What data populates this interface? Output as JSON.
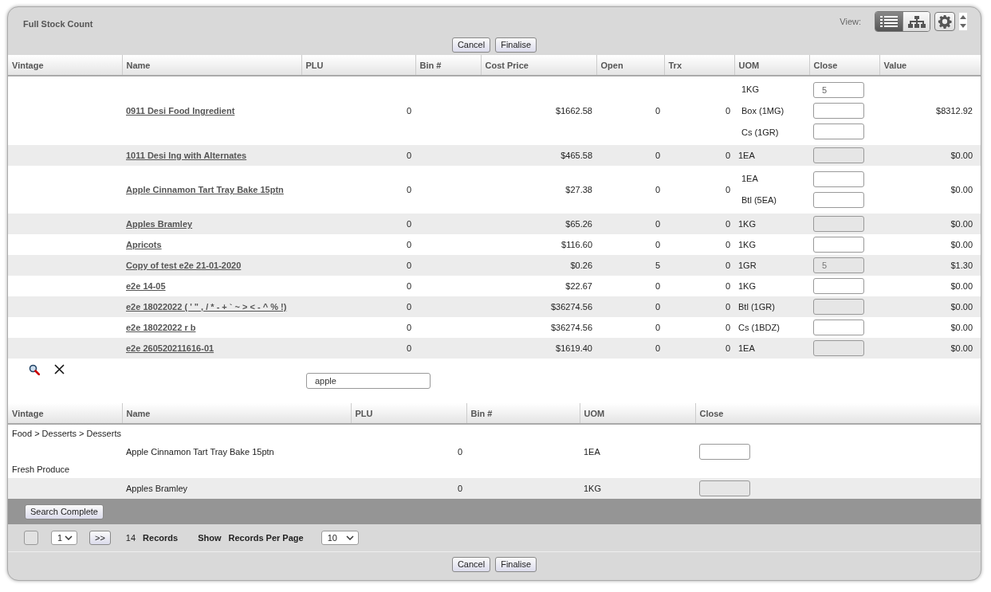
{
  "title": "Full Stock Count",
  "view": {
    "label": "View:",
    "modes": [
      {
        "kind": "list",
        "selected": true
      },
      {
        "kind": "tree",
        "selected": false
      }
    ]
  },
  "top_buttons": [
    "Cancel",
    "Finalise"
  ],
  "stock_table": {
    "columns": [
      "Vintage",
      "Name",
      "PLU",
      "Bin #",
      "Cost Price",
      "Open",
      "Trx",
      "UOM",
      "Close",
      "Value"
    ],
    "rows": [
      {
        "name": "0911 Desi Food Ingredient",
        "plu": "0",
        "cost_price": "$1662.58",
        "open": "0",
        "trx": "0",
        "uoms": [
          {
            "uom": "1KG",
            "close": "5",
            "disabled": false
          },
          {
            "uom": "Box (1MG)",
            "disabled": false
          },
          {
            "uom": "Cs (1GR)",
            "disabled": false
          }
        ],
        "value": "$8312.92"
      },
      {
        "name": "1011 Desi Ing with Alternates",
        "plu": "0",
        "cost_price": "$465.58",
        "open": "0",
        "trx": "0",
        "uoms": [
          {
            "uom": "1EA",
            "disabled": true
          }
        ],
        "value": "$0.00"
      },
      {
        "name": "Apple Cinnamon Tart Tray Bake 15ptn",
        "plu": "0",
        "cost_price": "$27.38",
        "open": "0",
        "trx": "0",
        "uoms": [
          {
            "uom": "1EA",
            "disabled": false
          },
          {
            "uom": "Btl (5EA)",
            "disabled": false
          }
        ],
        "value": "$0.00"
      },
      {
        "name": "Apples Bramley",
        "plu": "0",
        "cost_price": "$65.26",
        "open": "0",
        "trx": "0",
        "uoms": [
          {
            "uom": "1KG",
            "disabled": true
          }
        ],
        "value": "$0.00"
      },
      {
        "name": "Apricots",
        "plu": "0",
        "cost_price": "$116.60",
        "open": "0",
        "trx": "0",
        "uoms": [
          {
            "uom": "1KG",
            "disabled": false
          }
        ],
        "value": "$0.00"
      },
      {
        "name": "Copy of test e2e 21-01-2020",
        "plu": "0",
        "cost_price": "$0.26",
        "open": "5",
        "trx": "0",
        "uoms": [
          {
            "uom": "1GR",
            "close": "5",
            "disabled": true
          }
        ],
        "value": "$1.30"
      },
      {
        "name": "e2e 14-05",
        "plu": "0",
        "cost_price": "$22.67",
        "open": "0",
        "trx": "0",
        "uoms": [
          {
            "uom": "1KG",
            "disabled": false
          }
        ],
        "value": "$0.00"
      },
      {
        "name": "e2e 18022022 ( ' \" , / * - + ` ~ > < - ^ % !)",
        "plu": "0",
        "cost_price": "$36274.56",
        "open": "0",
        "trx": "0",
        "uoms": [
          {
            "uom": "Btl (1GR)",
            "disabled": true
          }
        ],
        "value": "$0.00"
      },
      {
        "name": "e2e 18022022 r b",
        "plu": "0",
        "cost_price": "$36274.56",
        "open": "0",
        "trx": "0",
        "uoms": [
          {
            "uom": "Cs (1BDZ)",
            "disabled": false
          }
        ],
        "value": "$0.00"
      },
      {
        "name": "e2e 260520211616-01",
        "plu": "0",
        "cost_price": "$1619.40",
        "open": "0",
        "trx": "0",
        "uoms": [
          {
            "uom": "1EA",
            "disabled": true
          }
        ],
        "value": "$0.00"
      }
    ]
  },
  "search": {
    "value": "apple"
  },
  "results_table": {
    "columns": [
      "Vintage",
      "Name",
      "PLU",
      "Bin #",
      "UOM",
      "Close"
    ],
    "groups": [
      {
        "category": "Food > Desserts > Desserts",
        "items": [
          {
            "name": "Apple Cinnamon Tart Tray Bake 15ptn",
            "plu": "0",
            "uom": "1EA",
            "disabled": false
          }
        ]
      },
      {
        "category": "Fresh Produce",
        "items": [
          {
            "name": "Apples Bramley",
            "plu": "0",
            "uom": "1KG",
            "disabled": true
          }
        ]
      }
    ]
  },
  "search_complete_button": "Search Complete",
  "pager": {
    "page": "1",
    "next": ">>",
    "count": "14",
    "records_label": "Records",
    "show_label": "Show",
    "per_page_label": "Records Per Page",
    "per_page": "10"
  },
  "bottom_buttons": [
    "Cancel",
    "Finalise"
  ]
}
